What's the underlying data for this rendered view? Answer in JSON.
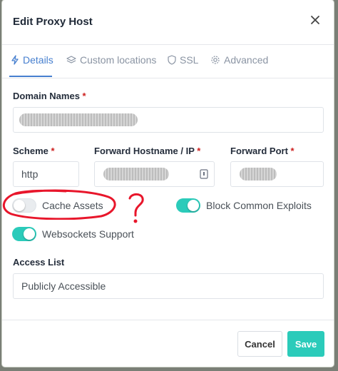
{
  "modal": {
    "title": "Edit Proxy Host",
    "close_icon": "close-icon"
  },
  "tabs": [
    {
      "label": "Details",
      "icon": "lightning-icon",
      "active": true
    },
    {
      "label": "Custom locations",
      "icon": "layers-icon",
      "active": false
    },
    {
      "label": "SSL",
      "icon": "shield-icon",
      "active": false
    },
    {
      "label": "Advanced",
      "icon": "gear-icon",
      "active": false
    }
  ],
  "form": {
    "domain_names_label": "Domain Names",
    "scheme_label": "Scheme",
    "scheme_value": "http",
    "forward_host_label": "Forward Hostname / IP",
    "forward_port_label": "Forward Port",
    "required_marker": "*",
    "cache_assets_label": "Cache Assets",
    "cache_assets_on": false,
    "block_exploits_label": "Block Common Exploits",
    "block_exploits_on": true,
    "websockets_label": "Websockets Support",
    "websockets_on": true,
    "access_list_label": "Access List",
    "access_list_value": "Publicly Accessible"
  },
  "footer": {
    "cancel_label": "Cancel",
    "save_label": "Save"
  },
  "annotation": {
    "mark": "?",
    "color": "#e8162b"
  },
  "colors": {
    "accent": "#467fcf",
    "toggle_on": "#2bcbba",
    "save_button": "#2bcbba",
    "required": "#cd201f"
  }
}
